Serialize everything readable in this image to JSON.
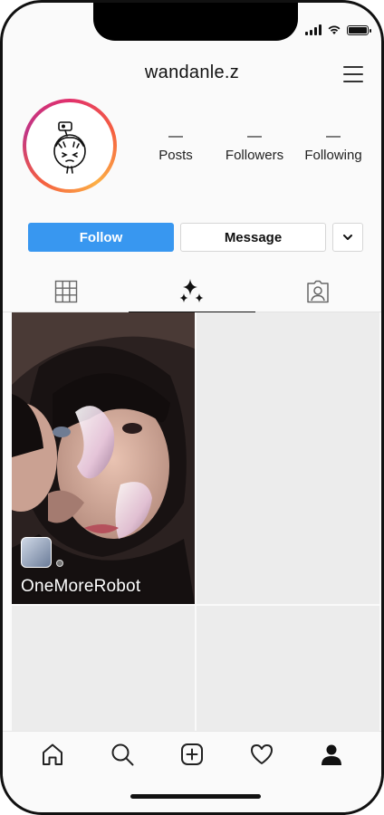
{
  "profile": {
    "username": "wandanle.z",
    "stats": [
      {
        "value": "—",
        "label": "Posts"
      },
      {
        "value": "—",
        "label": "Followers"
      },
      {
        "value": "—",
        "label": "Following"
      }
    ]
  },
  "actions": {
    "follow_label": "Follow",
    "message_label": "Message"
  },
  "tabs": [
    {
      "icon": "grid-icon",
      "active": false
    },
    {
      "icon": "effects-sparkle-icon",
      "active": true
    },
    {
      "icon": "tagged-person-icon",
      "active": false
    }
  ],
  "grid": {
    "items": [
      {
        "type": "effect-video",
        "effect_name": "OneMoreRobot"
      }
    ]
  },
  "bottom_nav": [
    "home-icon",
    "search-icon",
    "create-post-icon",
    "activity-heart-icon",
    "profile-icon"
  ],
  "colors": {
    "accent": "#3897f0",
    "ring_gradient": [
      "#e1306c",
      "#f56040",
      "#fcaf45",
      "#c13584"
    ]
  }
}
